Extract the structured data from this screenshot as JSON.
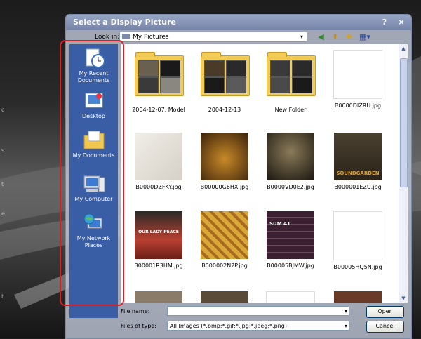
{
  "dialog": {
    "title": "Select a Display Picture",
    "help_label": "?",
    "close_label": "×"
  },
  "look_in": {
    "label": "Look in:",
    "value": "My Pictures"
  },
  "places": [
    {
      "label": "My Recent Documents",
      "icon": "recent-documents-icon"
    },
    {
      "label": "Desktop",
      "icon": "desktop-icon"
    },
    {
      "label": "My Documents",
      "icon": "my-documents-icon"
    },
    {
      "label": "My Computer",
      "icon": "my-computer-icon"
    },
    {
      "label": "My Network Places",
      "icon": "network-places-icon"
    }
  ],
  "files": [
    {
      "name": "2004-12-07, Model",
      "kind": "folder"
    },
    {
      "name": "2004-12-13",
      "kind": "folder"
    },
    {
      "name": "New Folder",
      "kind": "folder"
    },
    {
      "name": "B0000DIZRU.jpg",
      "kind": "image",
      "color": "#ffffff"
    },
    {
      "name": "B0000DZFKY.jpg",
      "kind": "image",
      "color": "#e6e2dc"
    },
    {
      "name": "B00000G6HX.jpg",
      "kind": "image",
      "color": "#7a4a18"
    },
    {
      "name": "B0000VD0E2.jpg",
      "kind": "image",
      "color": "#2a2418"
    },
    {
      "name": "B000001EZU.jpg",
      "kind": "image",
      "color": "#3a3020",
      "text": "SOUNDGARDEN"
    },
    {
      "name": "B00001R3HM.jpg",
      "kind": "image",
      "color": "#a03a2a",
      "text": "OUR LADY PEACE"
    },
    {
      "name": "B000002N2P.jpg",
      "kind": "image",
      "color": "#c49a34"
    },
    {
      "name": "B00005BJMW.jpg",
      "kind": "image",
      "color": "#4a2a3a",
      "text": "SUM 41"
    },
    {
      "name": "B00005HQ5N.jpg",
      "kind": "image",
      "color": "#ffffff"
    }
  ],
  "file_name": {
    "label": "File name:",
    "value": ""
  },
  "file_type": {
    "label": "Files of type:",
    "value": "All Images (*.bmp;*.gif;*.jpg;*.jpeg;*.png)"
  },
  "buttons": {
    "open": "Open",
    "cancel": "Cancel"
  },
  "toolbar_icons": [
    "back-icon",
    "up-folder-icon",
    "new-folder-icon",
    "views-menu-icon"
  ],
  "background_text": [
    "c",
    "s",
    "t",
    "e",
    "",
    "t"
  ]
}
